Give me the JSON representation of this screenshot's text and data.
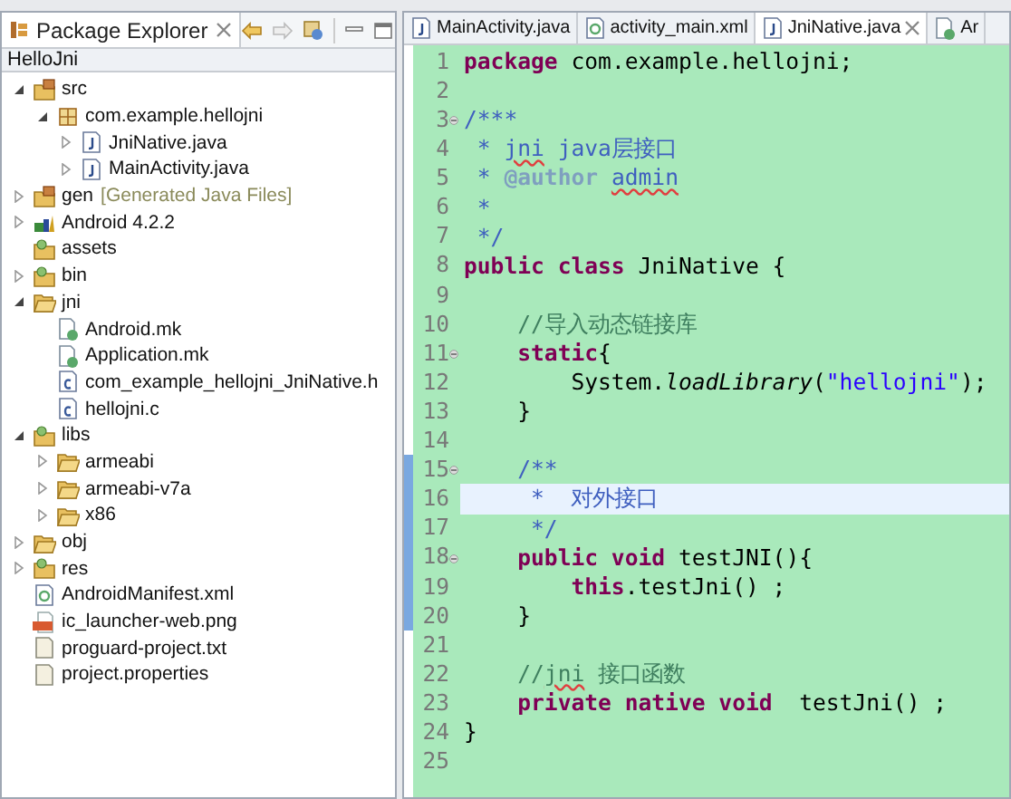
{
  "explorer": {
    "title": "Package Explorer",
    "project": "HelloJni",
    "tree": [
      {
        "label": "src",
        "kind": "source-folder",
        "expanded": true,
        "children": [
          {
            "label": "com.example.hellojni",
            "kind": "package",
            "expanded": true,
            "children": [
              {
                "label": "JniNative.java",
                "kind": "java-file",
                "expanded": false
              },
              {
                "label": "MainActivity.java",
                "kind": "java-file",
                "expanded": false
              }
            ]
          }
        ]
      },
      {
        "label": "gen",
        "decoration": "[Generated Java Files]",
        "kind": "source-folder",
        "expanded": false
      },
      {
        "label": "Android 4.2.2",
        "kind": "library",
        "expanded": false
      },
      {
        "label": "assets",
        "kind": "resource-folder"
      },
      {
        "label": "bin",
        "kind": "resource-folder",
        "expanded": false
      },
      {
        "label": "jni",
        "kind": "folder",
        "expanded": true,
        "children": [
          {
            "label": "Android.mk",
            "kind": "mk-file"
          },
          {
            "label": "Application.mk",
            "kind": "mk-file"
          },
          {
            "label": "com_example_hellojni_JniNative.h",
            "kind": "c-file"
          },
          {
            "label": "hellojni.c",
            "kind": "c-file"
          }
        ]
      },
      {
        "label": "libs",
        "kind": "resource-folder",
        "expanded": true,
        "children": [
          {
            "label": "armeabi",
            "kind": "folder",
            "expanded": false
          },
          {
            "label": "armeabi-v7a",
            "kind": "folder",
            "expanded": false
          },
          {
            "label": "x86",
            "kind": "folder",
            "expanded": false
          }
        ]
      },
      {
        "label": "obj",
        "kind": "folder",
        "expanded": false
      },
      {
        "label": "res",
        "kind": "resource-folder",
        "expanded": false
      },
      {
        "label": "AndroidManifest.xml",
        "kind": "xml-file"
      },
      {
        "label": "ic_launcher-web.png",
        "kind": "png-file"
      },
      {
        "label": "proguard-project.txt",
        "kind": "text-file"
      },
      {
        "label": "project.properties",
        "kind": "text-file"
      }
    ]
  },
  "editor": {
    "tabs": [
      {
        "label": "MainActivity.java",
        "kind": "java-file",
        "selected": false
      },
      {
        "label": "activity_main.xml",
        "kind": "xml-file",
        "selected": false
      },
      {
        "label": "JniNative.java",
        "kind": "java-file",
        "selected": true
      },
      {
        "label": "Ar",
        "kind": "mk-file",
        "selected": false
      }
    ],
    "lines": [
      {
        "number": "1",
        "fold": false,
        "changed": false,
        "current": false,
        "tokens": [
          {
            "kind": "keyword",
            "text": "package"
          },
          {
            "kind": "plain",
            "text": " com.example.hellojni;"
          }
        ]
      },
      {
        "number": "2",
        "fold": false,
        "changed": false,
        "current": false
      },
      {
        "number": "3",
        "fold": true,
        "changed": false,
        "current": false,
        "tokens": [
          {
            "kind": "doc",
            "text": "/***"
          }
        ]
      },
      {
        "number": "4",
        "fold": false,
        "changed": false,
        "current": false,
        "tokens": [
          {
            "kind": "doc",
            "text": " * "
          },
          {
            "kind": "doc-typo",
            "text": "jni"
          },
          {
            "kind": "doc",
            "text": " java层接口"
          }
        ]
      },
      {
        "number": "5",
        "fold": false,
        "changed": false,
        "current": false,
        "tokens": [
          {
            "kind": "doc",
            "text": " * "
          },
          {
            "kind": "doc-tag",
            "text": "@author "
          },
          {
            "kind": "doc-typo",
            "text": "admin"
          }
        ]
      },
      {
        "number": "6",
        "fold": false,
        "changed": false,
        "current": false,
        "tokens": [
          {
            "kind": "doc",
            "text": " *"
          }
        ]
      },
      {
        "number": "7",
        "fold": false,
        "changed": false,
        "current": false,
        "tokens": [
          {
            "kind": "doc",
            "text": " */"
          }
        ]
      },
      {
        "number": "8",
        "fold": false,
        "changed": false,
        "current": false,
        "tokens": [
          {
            "kind": "keyword",
            "text": "public class"
          },
          {
            "kind": "plain",
            "text": " JniNative {"
          }
        ]
      },
      {
        "number": "9",
        "fold": false,
        "changed": false,
        "current": false
      },
      {
        "number": "10",
        "fold": false,
        "changed": false,
        "current": false,
        "tokens": [
          {
            "kind": "comment",
            "text": "    //导入动态链接库"
          }
        ]
      },
      {
        "number": "11",
        "fold": true,
        "changed": false,
        "current": false,
        "tokens": [
          {
            "kind": "keyword",
            "text": "    static"
          },
          {
            "kind": "plain",
            "text": "{"
          }
        ]
      },
      {
        "number": "12",
        "fold": false,
        "changed": false,
        "current": false,
        "tokens": [
          {
            "kind": "plain",
            "text": "        System."
          },
          {
            "kind": "static-method",
            "text": "loadLibrary"
          },
          {
            "kind": "plain",
            "text": "("
          },
          {
            "kind": "string",
            "text": "\"hellojni\""
          },
          {
            "kind": "plain",
            "text": ");"
          }
        ]
      },
      {
        "number": "13",
        "fold": false,
        "changed": false,
        "current": false,
        "tokens": [
          {
            "kind": "plain",
            "text": "    }"
          }
        ]
      },
      {
        "number": "14",
        "fold": false,
        "changed": false,
        "current": false
      },
      {
        "number": "15",
        "fold": true,
        "changed": true,
        "current": false,
        "tokens": [
          {
            "kind": "doc",
            "text": "    /**"
          }
        ]
      },
      {
        "number": "16",
        "fold": false,
        "changed": true,
        "current": true,
        "tokens": [
          {
            "kind": "doc",
            "text": "     *  对外接口"
          }
        ]
      },
      {
        "number": "17",
        "fold": false,
        "changed": true,
        "current": false,
        "tokens": [
          {
            "kind": "doc",
            "text": "     */"
          }
        ]
      },
      {
        "number": "18",
        "fold": true,
        "changed": true,
        "current": false,
        "tokens": [
          {
            "kind": "keyword",
            "text": "    public void"
          },
          {
            "kind": "plain",
            "text": " testJNI(){"
          }
        ]
      },
      {
        "number": "19",
        "fold": false,
        "changed": true,
        "current": false,
        "tokens": [
          {
            "kind": "keyword",
            "text": "        this"
          },
          {
            "kind": "plain",
            "text": ".testJni() ;"
          }
        ]
      },
      {
        "number": "20",
        "fold": false,
        "changed": true,
        "current": false,
        "tokens": [
          {
            "kind": "plain",
            "text": "    }"
          }
        ]
      },
      {
        "number": "21",
        "fold": false,
        "changed": false,
        "current": false
      },
      {
        "number": "22",
        "fold": false,
        "changed": false,
        "current": false,
        "tokens": [
          {
            "kind": "comment",
            "text": "    //"
          },
          {
            "kind": "comment-typo",
            "text": "jni"
          },
          {
            "kind": "comment",
            "text": " 接口函数"
          }
        ]
      },
      {
        "number": "23",
        "fold": false,
        "changed": false,
        "current": false,
        "tokens": [
          {
            "kind": "keyword",
            "text": "    private native void"
          },
          {
            "kind": "plain",
            "text": "  testJni() ;"
          }
        ]
      },
      {
        "number": "24",
        "fold": false,
        "changed": false,
        "current": false,
        "tokens": [
          {
            "kind": "plain",
            "text": "}"
          }
        ]
      },
      {
        "number": "25",
        "fold": false,
        "changed": false,
        "current": false
      }
    ]
  }
}
